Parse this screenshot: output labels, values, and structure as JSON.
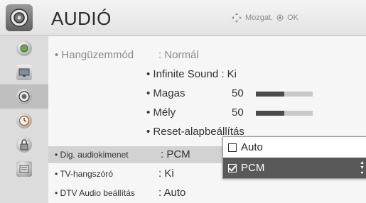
{
  "header": {
    "title": "AUDIÓ",
    "hint_move": "Mozgat.",
    "hint_ok": "OK",
    "icon": "speaker-icon"
  },
  "nav": {
    "items": [
      {
        "icon": "globe-icon"
      },
      {
        "icon": "picture-icon"
      },
      {
        "icon": "audio-icon",
        "active": true
      },
      {
        "icon": "clock-icon"
      },
      {
        "icon": "lock-icon"
      },
      {
        "icon": "options-icon"
      }
    ]
  },
  "menu": {
    "rows": [
      {
        "label": "• Hangüzemmód",
        "value": ": Normál"
      },
      {
        "label": "• Infinite Sound : Ki"
      },
      {
        "label": "• Magas",
        "value": "50",
        "level": 0.5
      },
      {
        "label": "• Mély",
        "value": "50",
        "level": 0.5
      },
      {
        "label": "• Reset-alapbeállítás"
      },
      {
        "label": "• Dig. audiokimenet",
        "value": ": PCM"
      },
      {
        "label": "• TV-hangszóró",
        "value": ": Ki"
      },
      {
        "label": "• DTV Audio beállítás",
        "value": ": Auto"
      }
    ]
  },
  "dropdown": {
    "options": [
      "Auto",
      "PCM"
    ],
    "selected": "PCM"
  },
  "colors": {
    "selected_row": "#d2d2d2",
    "dropdown_selected": "#595959",
    "bar_fill": "#4b4b4b"
  }
}
